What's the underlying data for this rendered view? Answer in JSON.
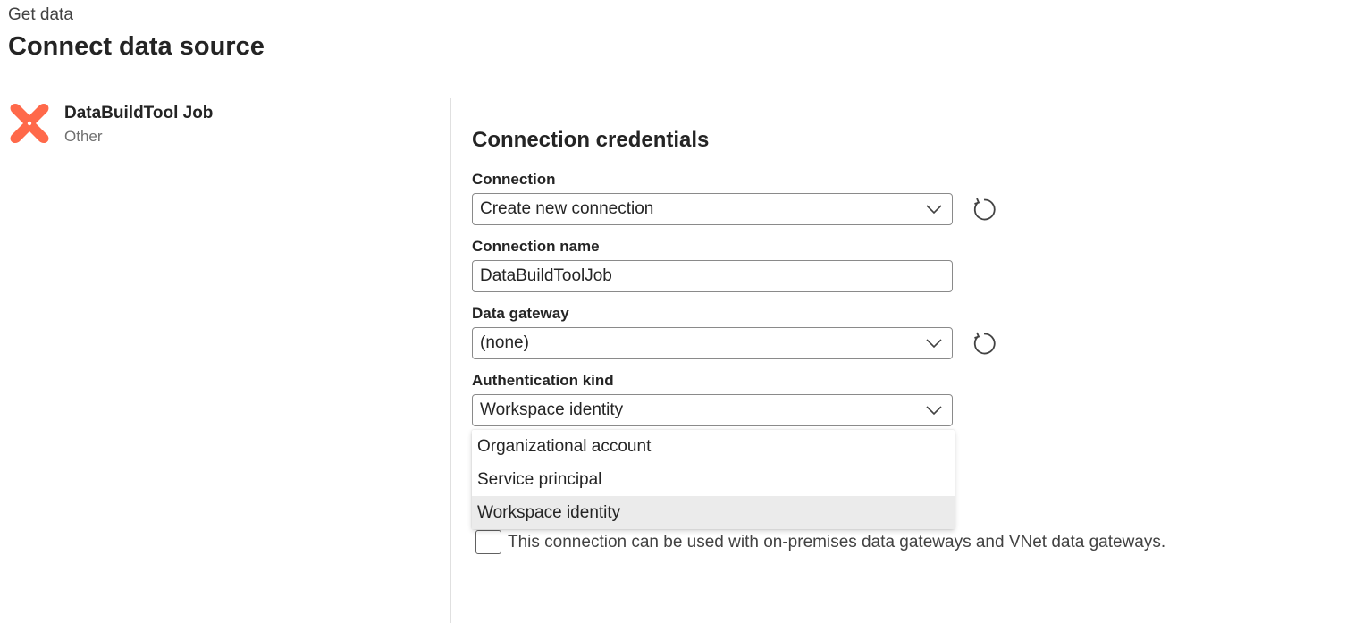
{
  "header": {
    "breadcrumb": "Get data",
    "title": "Connect data source"
  },
  "connector": {
    "name": "DataBuildTool Job",
    "category": "Other",
    "logo_icon": "dbt-logo-icon",
    "logo_color": "#FF694A"
  },
  "credentials": {
    "section_title": "Connection credentials",
    "connection": {
      "label": "Connection",
      "value": "Create new connection"
    },
    "connection_name": {
      "label": "Connection name",
      "value": "DataBuildToolJob"
    },
    "data_gateway": {
      "label": "Data gateway",
      "value": "(none)"
    },
    "authentication_kind": {
      "label": "Authentication kind",
      "value": "Workspace identity",
      "options": [
        "Organizational account",
        "Service principal",
        "Workspace identity"
      ],
      "selected_option": "Workspace identity"
    },
    "gateway_checkbox": {
      "label": "This connection can be used with on-premises data gateways and VNet data gateways.",
      "checked": false
    }
  },
  "icons": {
    "dropdown": "chevron-down-icon",
    "refresh": "refresh-icon"
  }
}
